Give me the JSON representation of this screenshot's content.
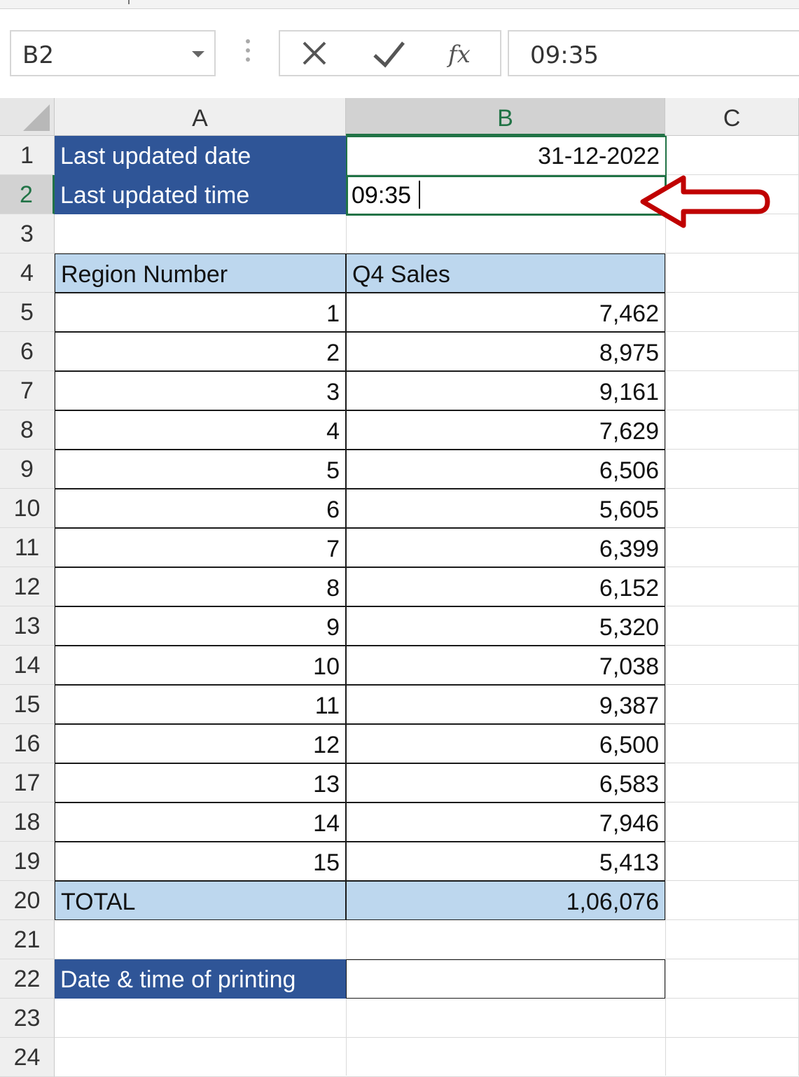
{
  "formula_bar": {
    "name_box": "B2",
    "formula_value": "09:35",
    "cancel_icon": "close-x-icon",
    "enter_icon": "checkmark-icon",
    "function_label": "fx"
  },
  "columns": [
    "A",
    "B",
    "C"
  ],
  "active_column": "B",
  "active_row": "2",
  "rows": [
    "1",
    "2",
    "3",
    "4",
    "5",
    "6",
    "7",
    "8",
    "9",
    "10",
    "11",
    "12",
    "13",
    "14",
    "15",
    "16",
    "17",
    "18",
    "19",
    "20",
    "21",
    "22",
    "23",
    "24"
  ],
  "sheet": {
    "a1": "Last updated date",
    "b1": "31-12-2022",
    "a2": "Last updated time",
    "b2": "09:35",
    "table_header": {
      "region": "Region Number",
      "sales": "Q4 Sales"
    },
    "table_rows": [
      {
        "region": "1",
        "sales": "7,462"
      },
      {
        "region": "2",
        "sales": "8,975"
      },
      {
        "region": "3",
        "sales": "9,161"
      },
      {
        "region": "4",
        "sales": "7,629"
      },
      {
        "region": "5",
        "sales": "6,506"
      },
      {
        "region": "6",
        "sales": "5,605"
      },
      {
        "region": "7",
        "sales": "6,399"
      },
      {
        "region": "8",
        "sales": "6,152"
      },
      {
        "region": "9",
        "sales": "5,320"
      },
      {
        "region": "10",
        "sales": "7,038"
      },
      {
        "region": "11",
        "sales": "9,387"
      },
      {
        "region": "12",
        "sales": "6,500"
      },
      {
        "region": "13",
        "sales": "6,583"
      },
      {
        "region": "14",
        "sales": "7,946"
      },
      {
        "region": "15",
        "sales": "5,413"
      }
    ],
    "total_label": "TOTAL",
    "total_value": "1,06,076",
    "print_label": "Date & time of printing",
    "print_value": ""
  },
  "colors": {
    "header_blue": "#2f5597",
    "light_blue": "#bdd7ee",
    "selection_green": "#217346",
    "annotation_red": "#c00000"
  },
  "annotation": {
    "icon": "left-arrow-icon"
  }
}
